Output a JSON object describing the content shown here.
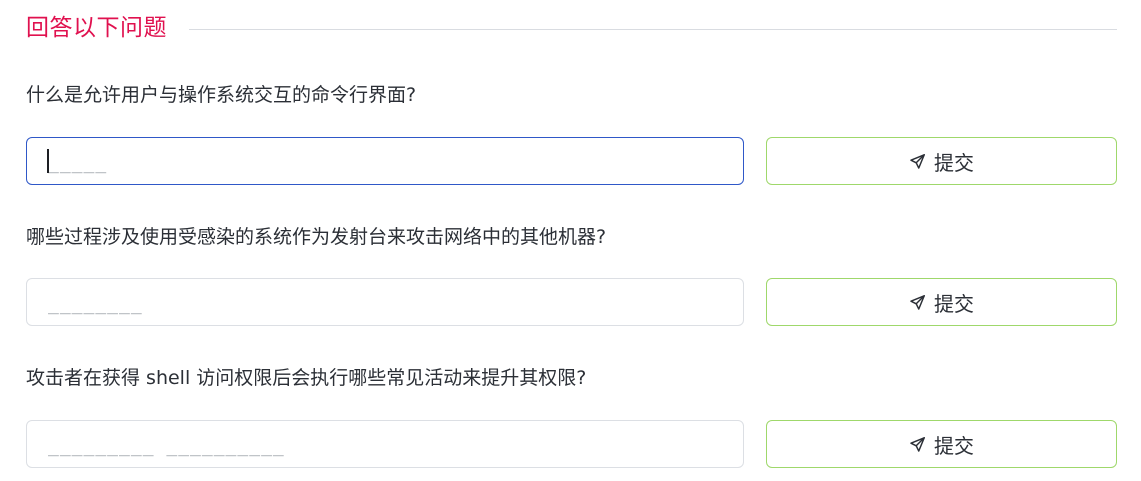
{
  "section": {
    "title": "回答以下问题"
  },
  "questions": [
    {
      "text": "什么是允许用户与操作系统交互的命令行界面?",
      "placeholder": "_____",
      "submit_label": "提交"
    },
    {
      "text": "哪些过程涉及使用受感染的系统作为发射台来攻击网络中的其他机器?",
      "placeholder": "________",
      "submit_label": "提交"
    },
    {
      "text": "攻击者在获得 shell 访问权限后会执行哪些常见活动来提升其权限?",
      "placeholder": "_________ __________",
      "submit_label": "提交"
    }
  ],
  "icons": {
    "submit": "send-icon"
  },
  "colors": {
    "accent_title": "#e0114f",
    "button_border": "#9fd86b",
    "focused_input_border": "#2f58c8"
  }
}
